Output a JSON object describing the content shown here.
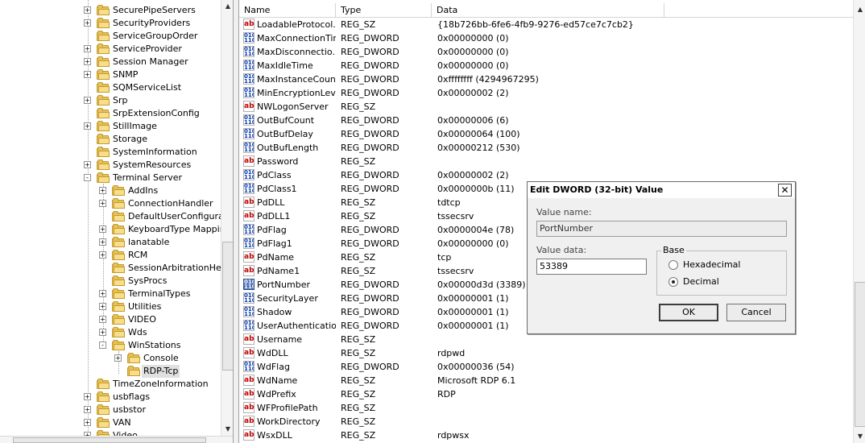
{
  "tree": {
    "items": [
      {
        "label": "SecurePipeServers",
        "expander": "+"
      },
      {
        "label": "SecurityProviders",
        "expander": "+"
      },
      {
        "label": "ServiceGroupOrder",
        "expander": ""
      },
      {
        "label": "ServiceProvider",
        "expander": "+"
      },
      {
        "label": "Session Manager",
        "expander": "+"
      },
      {
        "label": "SNMP",
        "expander": "+"
      },
      {
        "label": "SQMServiceList",
        "expander": ""
      },
      {
        "label": "Srp",
        "expander": "+"
      },
      {
        "label": "SrpExtensionConfig",
        "expander": ""
      },
      {
        "label": "StillImage",
        "expander": "+"
      },
      {
        "label": "Storage",
        "expander": ""
      },
      {
        "label": "SystemInformation",
        "expander": ""
      },
      {
        "label": "SystemResources",
        "expander": "+"
      },
      {
        "label": "Terminal Server",
        "expander": "-"
      },
      {
        "label": "AddIns",
        "expander": "+"
      },
      {
        "label": "ConnectionHandler",
        "expander": "+"
      },
      {
        "label": "DefaultUserConfiguratio",
        "expander": ""
      },
      {
        "label": "KeyboardType Mapping",
        "expander": "+"
      },
      {
        "label": "lanatable",
        "expander": "+"
      },
      {
        "label": "RCM",
        "expander": "+"
      },
      {
        "label": "SessionArbitrationHelpe",
        "expander": ""
      },
      {
        "label": "SysProcs",
        "expander": ""
      },
      {
        "label": "TerminalTypes",
        "expander": "+"
      },
      {
        "label": "Utilities",
        "expander": "+"
      },
      {
        "label": "VIDEO",
        "expander": "+"
      },
      {
        "label": "Wds",
        "expander": "+"
      },
      {
        "label": "WinStations",
        "expander": "-"
      },
      {
        "label": "Console",
        "expander": "+"
      },
      {
        "label": "RDP-Tcp",
        "expander": ""
      },
      {
        "label": "TimeZoneInformation",
        "expander": ""
      },
      {
        "label": "usbflags",
        "expander": "+"
      },
      {
        "label": "usbstor",
        "expander": "+"
      },
      {
        "label": "VAN",
        "expander": "+"
      },
      {
        "label": "Video",
        "expander": "+"
      }
    ]
  },
  "list": {
    "columns": {
      "name": "Name",
      "type": "Type",
      "data": "Data"
    },
    "rows": [
      {
        "name": "LoadableProtocol...",
        "type": "REG_SZ",
        "data": "{18b726bb-6fe6-4fb9-9276-ed57ce7c7cb2}",
        "icon": "ab"
      },
      {
        "name": "MaxConnectionTime",
        "type": "REG_DWORD",
        "data": "0x00000000 (0)",
        "icon": "dword"
      },
      {
        "name": "MaxDisconnectio...",
        "type": "REG_DWORD",
        "data": "0x00000000 (0)",
        "icon": "dword"
      },
      {
        "name": "MaxIdleTime",
        "type": "REG_DWORD",
        "data": "0x00000000 (0)",
        "icon": "dword"
      },
      {
        "name": "MaxInstanceCount",
        "type": "REG_DWORD",
        "data": "0xffffffff (4294967295)",
        "icon": "dword"
      },
      {
        "name": "MinEncryptionLevel",
        "type": "REG_DWORD",
        "data": "0x00000002 (2)",
        "icon": "dword"
      },
      {
        "name": "NWLogonServer",
        "type": "REG_SZ",
        "data": "",
        "icon": "ab"
      },
      {
        "name": "OutBufCount",
        "type": "REG_DWORD",
        "data": "0x00000006 (6)",
        "icon": "dword"
      },
      {
        "name": "OutBufDelay",
        "type": "REG_DWORD",
        "data": "0x00000064 (100)",
        "icon": "dword"
      },
      {
        "name": "OutBufLength",
        "type": "REG_DWORD",
        "data": "0x00000212 (530)",
        "icon": "dword"
      },
      {
        "name": "Password",
        "type": "REG_SZ",
        "data": "",
        "icon": "ab"
      },
      {
        "name": "PdClass",
        "type": "REG_DWORD",
        "data": "0x00000002 (2)",
        "icon": "dword"
      },
      {
        "name": "PdClass1",
        "type": "REG_DWORD",
        "data": "0x0000000b (11)",
        "icon": "dword"
      },
      {
        "name": "PdDLL",
        "type": "REG_SZ",
        "data": "tdtcp",
        "icon": "ab"
      },
      {
        "name": "PdDLL1",
        "type": "REG_SZ",
        "data": "tssecsrv",
        "icon": "ab"
      },
      {
        "name": "PdFlag",
        "type": "REG_DWORD",
        "data": "0x0000004e (78)",
        "icon": "dword"
      },
      {
        "name": "PdFlag1",
        "type": "REG_DWORD",
        "data": "0x00000000 (0)",
        "icon": "dword"
      },
      {
        "name": "PdName",
        "type": "REG_SZ",
        "data": "tcp",
        "icon": "ab"
      },
      {
        "name": "PdName1",
        "type": "REG_SZ",
        "data": "tssecsrv",
        "icon": "ab"
      },
      {
        "name": "PortNumber",
        "type": "REG_DWORD",
        "data": "0x00000d3d (3389)",
        "icon": "dword-selected"
      },
      {
        "name": "SecurityLayer",
        "type": "REG_DWORD",
        "data": "0x00000001 (1)",
        "icon": "dword"
      },
      {
        "name": "Shadow",
        "type": "REG_DWORD",
        "data": "0x00000001 (1)",
        "icon": "dword"
      },
      {
        "name": "UserAuthentication",
        "type": "REG_DWORD",
        "data": "0x00000001 (1)",
        "icon": "dword"
      },
      {
        "name": "Username",
        "type": "REG_SZ",
        "data": "",
        "icon": "ab"
      },
      {
        "name": "WdDLL",
        "type": "REG_SZ",
        "data": "rdpwd",
        "icon": "ab"
      },
      {
        "name": "WdFlag",
        "type": "REG_DWORD",
        "data": "0x00000036 (54)",
        "icon": "dword"
      },
      {
        "name": "WdName",
        "type": "REG_SZ",
        "data": "Microsoft RDP 6.1",
        "icon": "ab"
      },
      {
        "name": "WdPrefix",
        "type": "REG_SZ",
        "data": "RDP",
        "icon": "ab"
      },
      {
        "name": "WFProfilePath",
        "type": "REG_SZ",
        "data": "",
        "icon": "ab"
      },
      {
        "name": "WorkDirectory",
        "type": "REG_SZ",
        "data": "",
        "icon": "ab"
      },
      {
        "name": "WsxDLL",
        "type": "REG_SZ",
        "data": "rdpwsx",
        "icon": "ab"
      }
    ]
  },
  "dialog": {
    "title": "Edit DWORD (32-bit) Value",
    "close_glyph": "✕",
    "value_name_label": "Value name:",
    "value_name": "PortNumber",
    "value_data_label": "Value data:",
    "value_data": "53389",
    "base_label": "Base",
    "radio_hex": "Hexadecimal",
    "radio_dec": "Decimal",
    "selected_base": "Decimal",
    "ok_label": "OK",
    "cancel_label": "Cancel"
  },
  "icons": {
    "string_value": "ab-icon",
    "dword_value": "binary-value-icon",
    "registry_key": "folder-icon"
  }
}
